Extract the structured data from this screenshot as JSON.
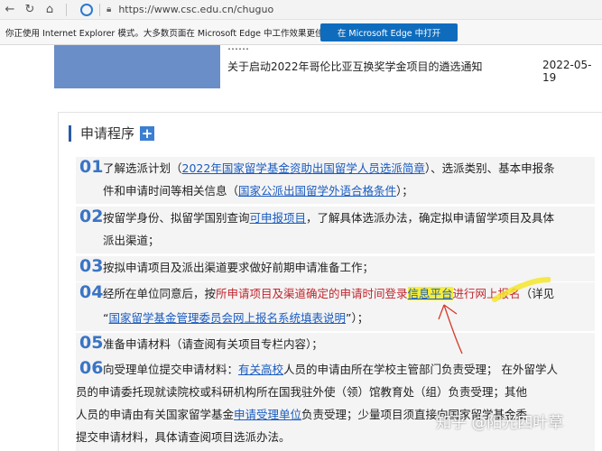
{
  "browser": {
    "url": "https://www.csc.edu.cn/chuguo",
    "ie_notice": "你正使用 Internet Explorer 模式。大多数页面在 Microsoft Edge 中工作效果更佳。",
    "edge_button": "在 Microsoft Edge 中打开"
  },
  "news": {
    "cut_title": "……",
    "title": "关于启动2022年哥伦比亚互换奖学金项目的遴选通知",
    "date": "2022-05-19"
  },
  "section": {
    "title": "申请程序",
    "plus": "+"
  },
  "steps": [
    {
      "num": "01",
      "l1_a": "了解选派计划（",
      "l1_link": "2022年国家留学基金资助出国留学人员选派简章",
      "l1_b": "）、选派类别、基本申报条",
      "l2_a": "件和申请时间等相关信息（",
      "l2_link": "国家公派出国留学外语合格条件",
      "l2_b": "）；"
    },
    {
      "num": "02",
      "l1_a": "按留学身份、拟留学国别查询",
      "l1_link": "可申报项目",
      "l1_b": "，了解具体选派办法，确定拟申请留学项目及具体",
      "l2": "派出渠道；"
    },
    {
      "num": "03",
      "l1": "按拟申请项目及派出渠道要求做好前期申请准备工作；"
    },
    {
      "num": "04",
      "l1_a": "经所在单位同意后，按",
      "l1_red": "所申请项目及渠道确定的申请时间登录",
      "l1_link": "信息平台",
      "l1_red2": "进行网上报名",
      "l1_b": "（详见",
      "l2_a": "“",
      "l2_link": "国家留学基金管理委员会网上报名系统填表说明",
      "l2_b": "”）；"
    },
    {
      "num": "05",
      "l1": "准备申请材料（请查阅有关项目专栏内容）；"
    },
    {
      "num": "06",
      "l1_a": "向受理单位提交申请材料：",
      "l1_link": "有关高校",
      "l1_b": "人员的申请由所在学校主管部门负责受理；  在外留学人",
      "l2": "员的申请委托现就读院校或科研机构所在国我驻外使（领）馆教育处（组）负责受理；其他",
      "l3_a": "人员的申请由有关国家留学基金",
      "l3_link": "申请受理单位",
      "l3_b": "负责受理；少量项目须直接向国家留学基金委",
      "l4": "提交申请材料，具体请查阅项目选派办法。"
    }
  ],
  "watermark": "知乎 @阳光四叶草",
  "colors": {
    "accent": "#3a74c5",
    "link": "#1a5bbf",
    "red_text": "#c0262d",
    "highlight": "#f7ee39",
    "edge_button": "#0f6cbd"
  }
}
